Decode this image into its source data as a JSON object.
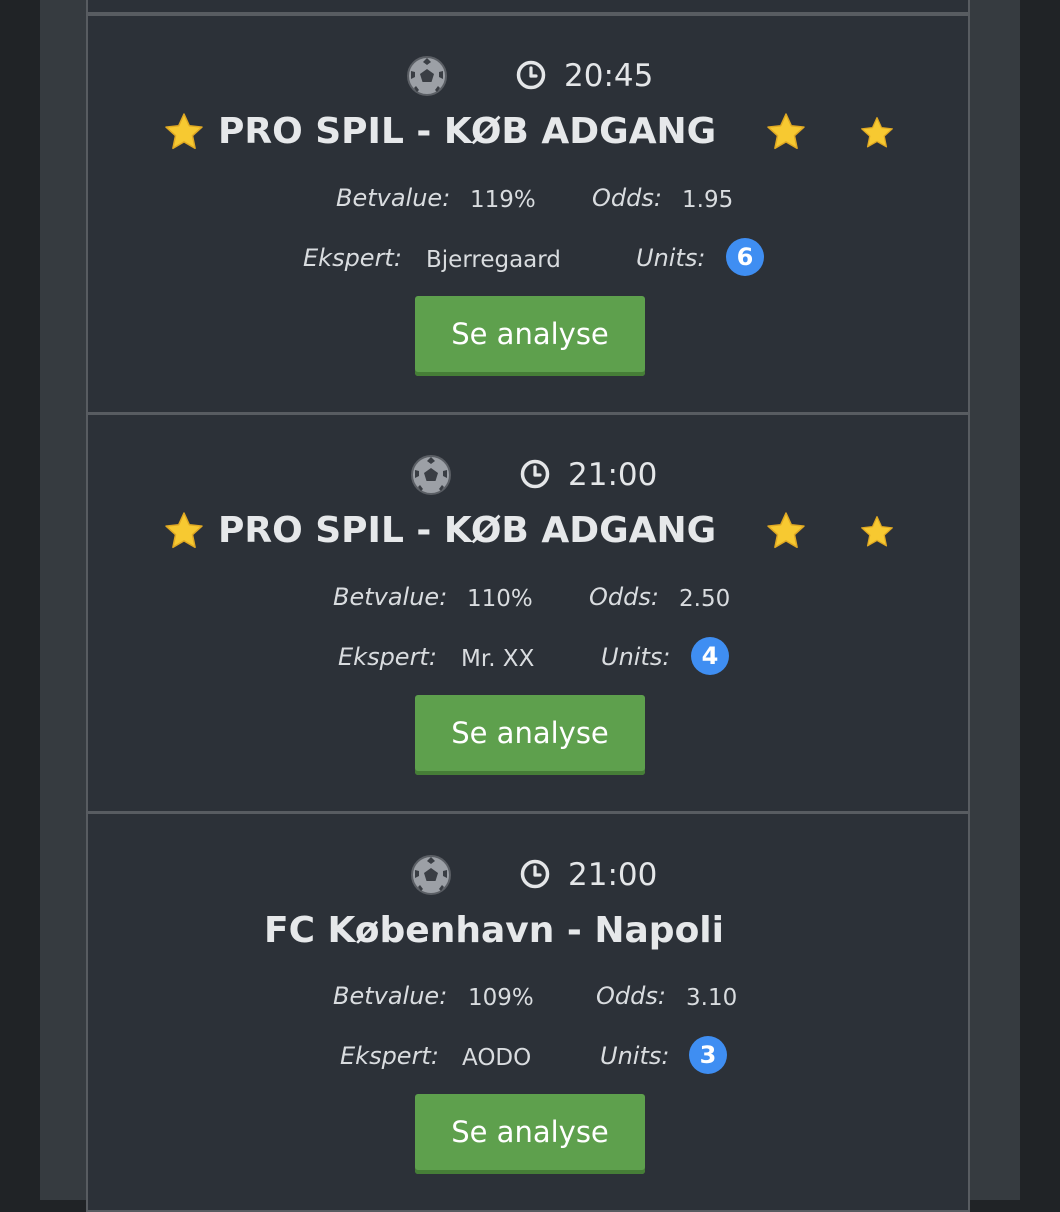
{
  "cards": [
    {
      "time": "20:45",
      "title": "PRO SPIL - KØB ADGANG",
      "pro": true,
      "betvalue_label": "Betvalue:",
      "betvalue": "119%",
      "odds_label": "Odds:",
      "odds": "1.95",
      "ekspert_label": "Ekspert:",
      "ekspert": "Bjerregaard",
      "units_label": "Units:",
      "units": "6",
      "button_label": "Se analyse"
    },
    {
      "time": "21:00",
      "title": "PRO SPIL - KØB ADGANG",
      "pro": true,
      "betvalue_label": "Betvalue:",
      "betvalue": "110%",
      "odds_label": "Odds:",
      "odds": "2.50",
      "ekspert_label": "Ekspert:",
      "ekspert": "Mr. XX",
      "units_label": "Units:",
      "units": "4",
      "button_label": "Se analyse"
    },
    {
      "time": "21:00",
      "title": "FC København - Napoli",
      "pro": false,
      "betvalue_label": "Betvalue:",
      "betvalue": "109%",
      "odds_label": "Odds:",
      "odds": "3.10",
      "ekspert_label": "Ekspert:",
      "ekspert": "AODO",
      "units_label": "Units:",
      "units": "3",
      "button_label": "Se analyse"
    }
  ],
  "colors": {
    "page_bg": "#202326",
    "outer_bg": "#363b40",
    "card_bg": "#2c3138",
    "card_border": "#585c61",
    "button_green": "#5ea04d",
    "badge_blue": "#3f8ef2",
    "star_yellow": "#f7c931"
  },
  "icons": {
    "sport": "soccer-ball-icon",
    "time": "clock-icon",
    "pro": "star-icon"
  }
}
